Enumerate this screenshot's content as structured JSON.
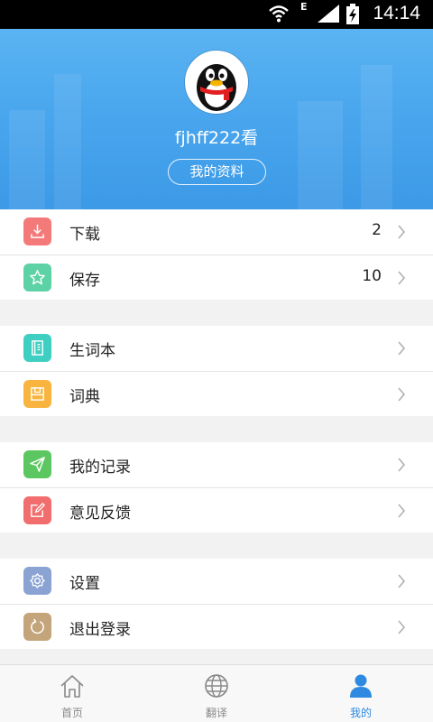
{
  "status_bar": {
    "time": "14:14",
    "network_type": "E"
  },
  "profile": {
    "username": "fjhff222看",
    "profile_button": "我的资料"
  },
  "menu": {
    "groups": [
      {
        "items": [
          {
            "label": "下载",
            "count": "2",
            "icon": "download-icon",
            "color": "#f47a7a"
          },
          {
            "label": "保存",
            "count": "10",
            "icon": "star-icon",
            "color": "#5cd2a6"
          }
        ]
      },
      {
        "items": [
          {
            "label": "生词本",
            "icon": "notebook-icon",
            "color": "#3fcfc2"
          },
          {
            "label": "词典",
            "icon": "dictionary-icon",
            "color": "#f8b43f"
          }
        ]
      },
      {
        "items": [
          {
            "label": "我的记录",
            "icon": "send-icon",
            "color": "#5cc760"
          },
          {
            "label": "意见反馈",
            "icon": "edit-icon",
            "color": "#f26d6d"
          }
        ]
      },
      {
        "items": [
          {
            "label": "设置",
            "icon": "gear-icon",
            "color": "#8aa3d2"
          },
          {
            "label": "退出登录",
            "icon": "logout-icon",
            "color": "#c4a47a"
          }
        ]
      }
    ]
  },
  "bottom_nav": {
    "tabs": [
      {
        "label": "首页",
        "icon": "home-icon",
        "active": false
      },
      {
        "label": "翻译",
        "icon": "globe-icon",
        "active": false
      },
      {
        "label": "我的",
        "icon": "person-icon",
        "active": true
      }
    ]
  },
  "colors": {
    "header": "#4aa7ee",
    "active_tab": "#2d8ae0"
  }
}
